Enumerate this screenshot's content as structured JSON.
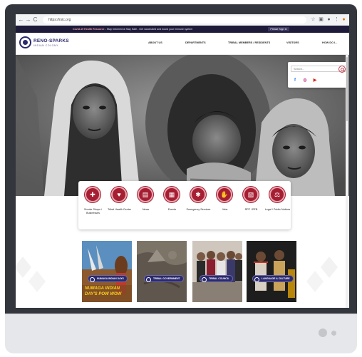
{
  "browser": {
    "url": "https://rsic.org",
    "back_label": "←",
    "forward_label": "→",
    "reload_label": "C"
  },
  "announcement": {
    "highlight": "Covid-19 Health Resource",
    "text": "Stay Informed & Stay Safe - Get vaccinated and boost your immune system",
    "button": "Please Sign In"
  },
  "site": {
    "logo_title": "RENO-SPARKS",
    "logo_subtitle": "INDIAN COLONY"
  },
  "nav": {
    "items": [
      {
        "label": "ABOUT US"
      },
      {
        "label": "DEPARTMENTS"
      },
      {
        "label": "TRIBAL MEMBERS / RESIDENTS"
      },
      {
        "label": "VISITORS"
      },
      {
        "label": "HOW DO I..."
      }
    ]
  },
  "search": {
    "placeholder": "Search..."
  },
  "social": {
    "facebook": "f",
    "instagram": "◎",
    "youtube": "▶"
  },
  "quick_links": [
    {
      "label": "Smoke Shops / Businesses",
      "icon": "store-icon"
    },
    {
      "label": "Tribal Health Center",
      "icon": "health-icon"
    },
    {
      "label": "News",
      "icon": "news-icon"
    },
    {
      "label": "Events",
      "icon": "calendar-icon"
    },
    {
      "label": "Emergency Services",
      "icon": "emergency-icon"
    },
    {
      "label": "Jobs",
      "icon": "handshake-icon"
    },
    {
      "label": "RFP / RFB",
      "icon": "document-icon"
    },
    {
      "label": "Legal / Public Notices",
      "icon": "gavel-icon"
    }
  ],
  "cards": [
    {
      "label": "NUMAGA INDIAN DAYS",
      "overlay_line1": "NUMAGA INDIAN",
      "overlay_line2": "DAY'S POW WOW"
    },
    {
      "label": "TRIBAL GOVERNMENT"
    },
    {
      "label": "TRIBAL COUNCIL"
    },
    {
      "label": "LANGUAGE & CULTURE"
    }
  ],
  "colors": {
    "brand_navy": "#2b2a6e",
    "brand_red": "#a51e32",
    "announcement_bg": "#1e1b3a"
  }
}
